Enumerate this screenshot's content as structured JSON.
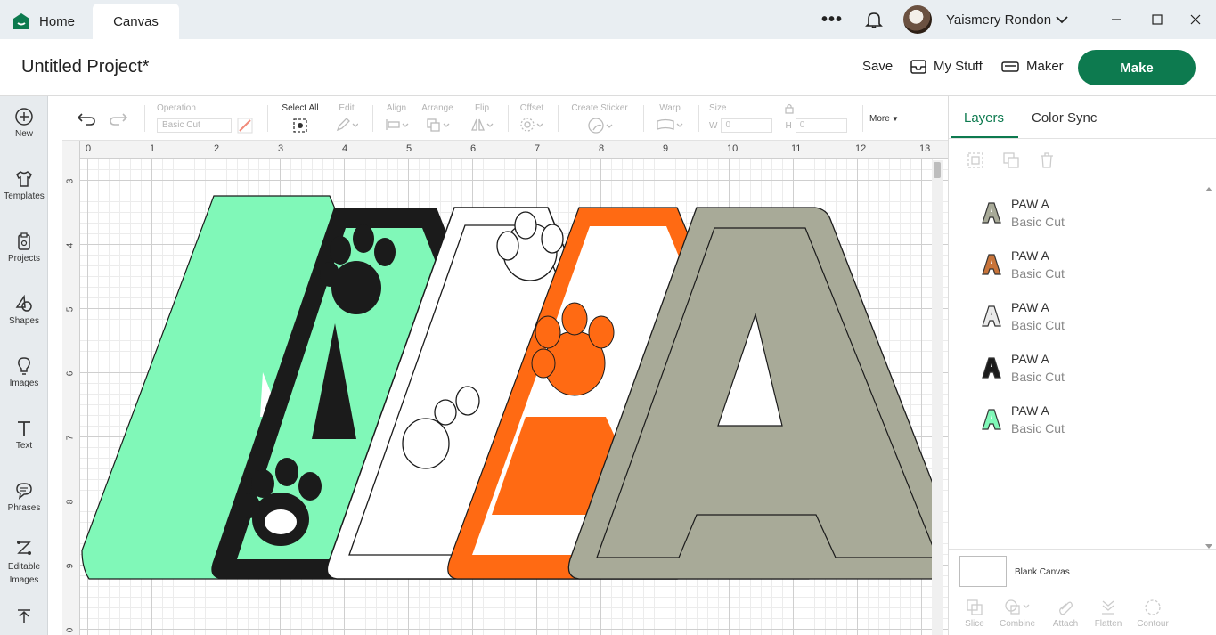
{
  "titlebar": {
    "home_label": "Home",
    "canvas_label": "Canvas",
    "more_label": "•••",
    "user_name": "Yaismery Rondon"
  },
  "header": {
    "project_title": "Untitled Project*",
    "save_label": "Save",
    "mystuff_label": "My Stuff",
    "maker_label": "Maker",
    "make_label": "Make"
  },
  "sidebar": {
    "items": [
      {
        "label": "New",
        "icon": "plus-circle-icon"
      },
      {
        "label": "Templates",
        "icon": "shirt-icon"
      },
      {
        "label": "Projects",
        "icon": "clipboard-icon"
      },
      {
        "label": "Shapes",
        "icon": "shapes-icon"
      },
      {
        "label": "Images",
        "icon": "lightbulb-icon"
      },
      {
        "label": "Text",
        "icon": "text-icon"
      },
      {
        "label": "Phrases",
        "icon": "speech-bubble-icon"
      },
      {
        "label": "Editable Images",
        "icon": "edit-nodes-icon"
      }
    ]
  },
  "toolbar": {
    "operation_label": "Operation",
    "operation_value": "Basic Cut",
    "select_all_label": "Select All",
    "edit_label": "Edit",
    "align_label": "Align",
    "arrange_label": "Arrange",
    "flip_label": "Flip",
    "offset_label": "Offset",
    "create_sticker_label": "Create Sticker",
    "warp_label": "Warp",
    "size_label": "Size",
    "w_label": "W",
    "h_label": "H",
    "w_value": "0",
    "h_value": "0",
    "more_label": "More"
  },
  "ruler": {
    "top": [
      "0",
      "1",
      "2",
      "3",
      "4",
      "5",
      "6",
      "7",
      "8",
      "9",
      "10",
      "11",
      "12",
      "13"
    ],
    "left": [
      "3",
      "4",
      "5",
      "6",
      "7",
      "8",
      "9",
      "0"
    ]
  },
  "right_panel": {
    "tabs": [
      "Layers",
      "Color Sync"
    ],
    "layers": [
      {
        "name": "PAW A",
        "type": "Basic Cut",
        "color": "#a8aa98"
      },
      {
        "name": "PAW A",
        "type": "Basic Cut",
        "color": "#ff6a13"
      },
      {
        "name": "PAW A",
        "type": "Basic Cut",
        "color": "#ffffff"
      },
      {
        "name": "PAW A",
        "type": "Basic Cut",
        "color": "#1b1b1b"
      },
      {
        "name": "PAW A",
        "type": "Basic Cut",
        "color": "#80f8b8"
      }
    ],
    "blank_canvas_label": "Blank Canvas",
    "bottom_tools": [
      "Slice",
      "Combine",
      "Attach",
      "Flatten",
      "Contour"
    ]
  },
  "colors": {
    "brand_green": "#0d7a4f",
    "mint": "#80f8b8",
    "black": "#1b1b1b",
    "orange": "#ff6a13",
    "sage": "#a8aa98"
  }
}
